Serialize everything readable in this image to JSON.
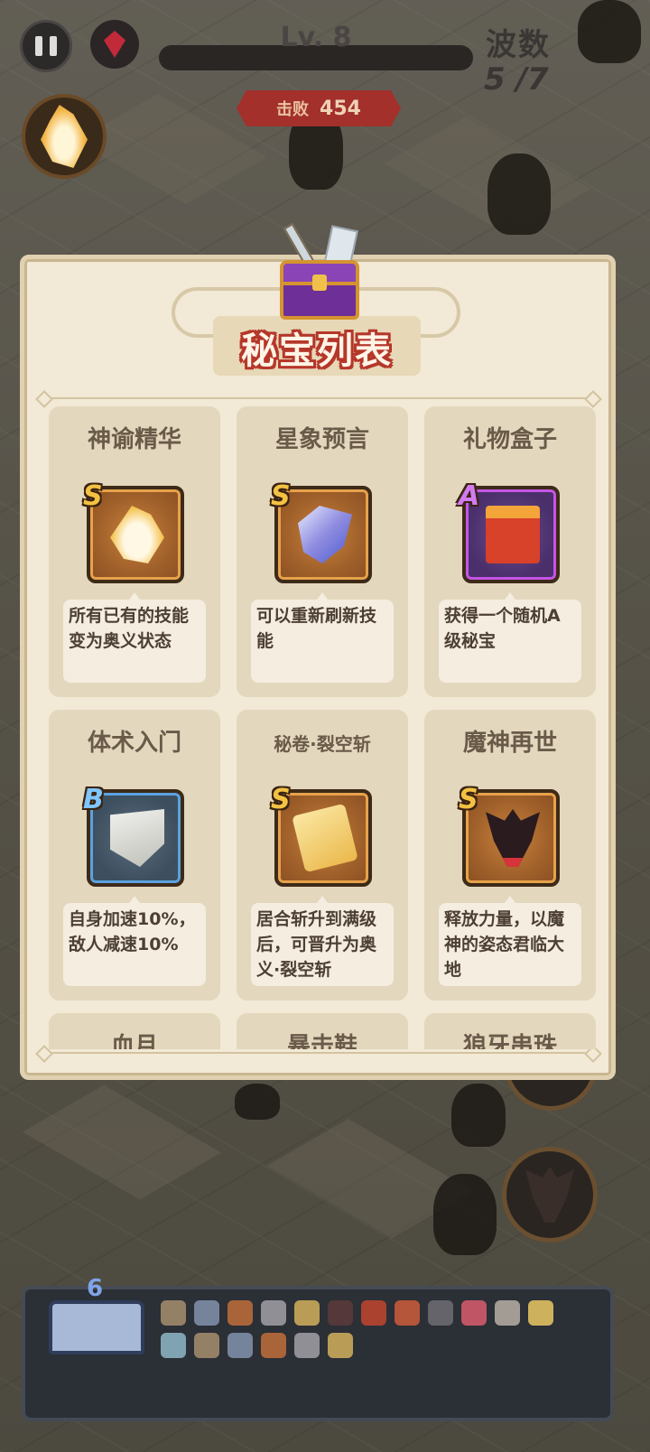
{
  "hud": {
    "level_text": "Lv. 8",
    "kill_label": "击败",
    "kill_count": "454",
    "wave_label": "波数",
    "wave_count": "5 /7"
  },
  "panel": {
    "title": "秘宝列表",
    "treasures": [
      {
        "name": "神谕精华",
        "grade": "S",
        "icon": "flame-shard-icon",
        "desc": "所有已有的技能变为奥义状态"
      },
      {
        "name": "星象预言",
        "grade": "S",
        "icon": "star-scroll-icon",
        "desc": "可以重新刷新技能"
      },
      {
        "name": "礼物盒子",
        "grade": "A",
        "icon": "gift-box-icon",
        "desc": "获得一个随机A级秘宝"
      },
      {
        "name": "体术入门",
        "grade": "B",
        "icon": "martial-scroll-icon",
        "desc": "自身加速10%，敌人减速10%"
      },
      {
        "name": "秘卷·裂空斩",
        "grade": "S",
        "icon": "golden-scroll-icon",
        "desc": "居合斩升到满级后，可晋升为奥义·裂空斩"
      },
      {
        "name": "魔神再世",
        "grade": "S",
        "icon": "demon-mask-icon",
        "desc": "释放力量，以魔神的姿态君临大地"
      },
      {
        "name": "血月",
        "grade": "",
        "icon": "",
        "desc": ""
      },
      {
        "name": "暴击鞋",
        "grade": "",
        "icon": "",
        "desc": ""
      },
      {
        "name": "狼牙串珠",
        "grade": "",
        "icon": "",
        "desc": ""
      }
    ]
  },
  "bottom_bar": {
    "book_count": "6",
    "owned_item_count": 18
  },
  "colors": {
    "panel_bg": "#f2e9d6",
    "card_bg": "#e3d7bd",
    "title_outline": "#b5372a",
    "grade_S": "#f4c243",
    "grade_A": "#d27af2",
    "grade_B": "#7fc6ff"
  }
}
